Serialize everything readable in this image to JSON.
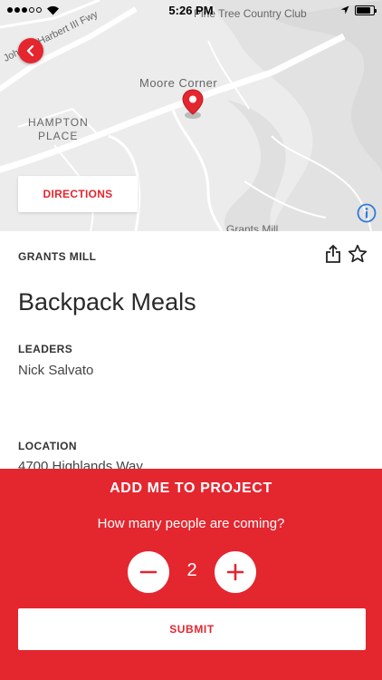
{
  "status_bar": {
    "time": "5:26 PM",
    "signal_icon": "signal-dots-icon",
    "wifi_icon": "wifi-icon",
    "location_icon": "location-arrow-icon",
    "battery_icon": "battery-icon"
  },
  "map": {
    "labels": {
      "road": "John M. Harbert III Fwy",
      "club": "Pine Tree Country Club",
      "area": "Moore Corner",
      "hampton": "HAMPTON",
      "place": "PLACE",
      "grants": "Grants Mill"
    },
    "directions_label": "DIRECTIONS",
    "accent_color": "#e4262f"
  },
  "project": {
    "category": "GRANTS MILL",
    "title": "Backpack Meals",
    "leaders_label": "LEADERS",
    "leaders_value": "Nick Salvato",
    "location_label": "LOCATION",
    "location_value": "4700 Highlands Way"
  },
  "panel": {
    "title": "ADD ME TO PROJECT",
    "question": "How many people are coming?",
    "count": "2",
    "submit_label": "SUBMIT",
    "background_color": "#e4262f"
  }
}
